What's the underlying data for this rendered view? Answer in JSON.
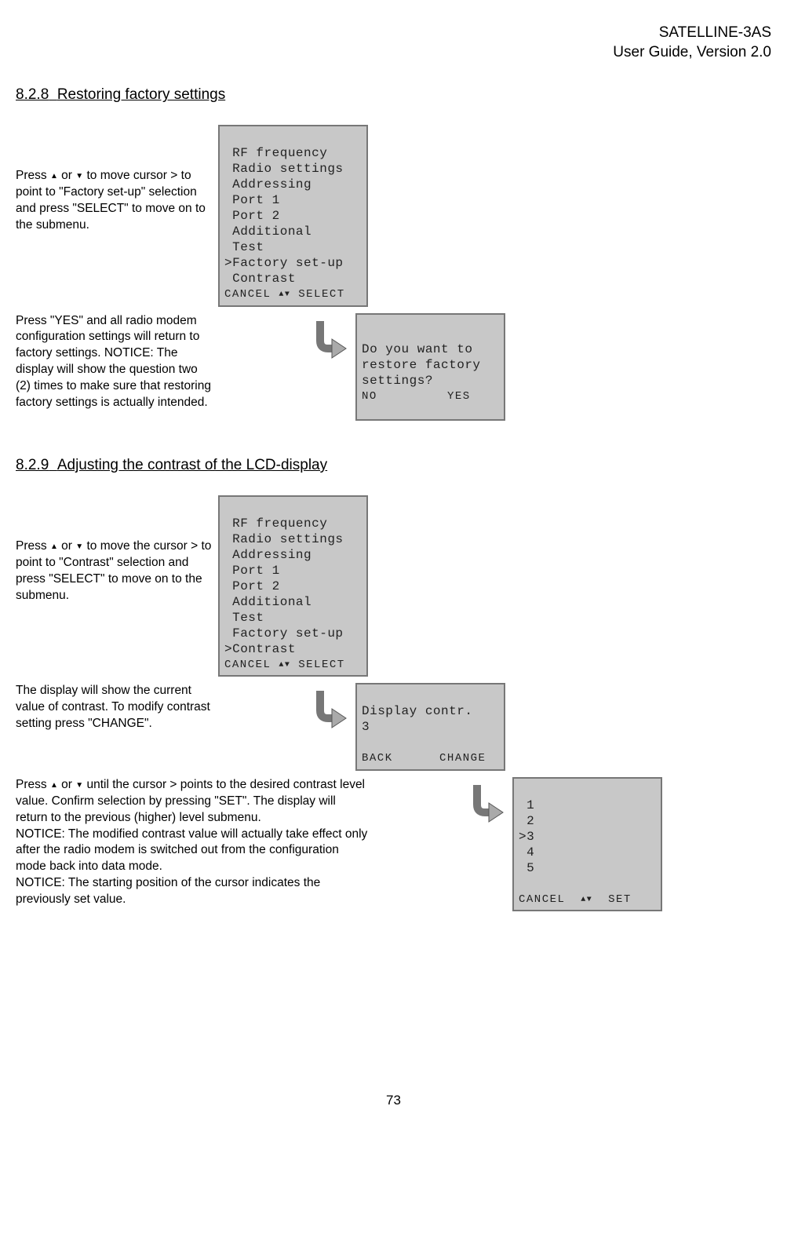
{
  "header": {
    "product": "SATELLINE-3AS",
    "guide": "User Guide, Version 2.0"
  },
  "section1": {
    "num": "8.2.8",
    "title": "Restoring factory settings",
    "instr1_a": "Press ",
    "instr1_b": " or ",
    "instr1_c": " to move cursor > to point to \"Factory set-up\" selection and press \"SELECT\" to move on to the submenu.",
    "instr2_a": "Press \"YES\" and all radio modem configuration settings will return to factory settings. ",
    "instr2_notice": "NOTICE:",
    "instr2_b": " The display will show the question two (2) times to make sure that restoring factory settings is actually intended.",
    "lcd1_lines": " RF frequency\n Radio settings\n Addressing\n Port 1\n Port 2\n Additional\n Test\n>Factory set-up\n Contrast",
    "lcd1_footer_left": "CANCEL",
    "lcd1_footer_right": "SELECT",
    "lcd2_lines": "Do you want to\nrestore factory\nsettings?",
    "lcd2_footer_left": "NO",
    "lcd2_footer_right": "YES"
  },
  "section2": {
    "num": "8.2.9",
    "title": "Adjusting the contrast of the LCD-display",
    "instr1_a": "Press ",
    "instr1_b": " or ",
    "instr1_c": " to move the cursor > to point to \"Contrast\" selection and press \"SELECT\" to move on to the submenu.",
    "instr2": "The display will show the current value of contrast. To modify contrast setting press \"CHANGE\".",
    "instr3_a": "Press ",
    "instr3_b": " or ",
    "instr3_c": "  until the cursor > points to the desired contrast level value. Confirm selection by pressing \"SET\". The display will return to the previous (higher) level submenu.",
    "instr3_notice1": "NOTICE:",
    "instr3_d": " The modified contrast value will actually take effect only after the radio modem is switched out from the configuration mode back into data mode.",
    "instr3_notice2": "NOTICE:",
    "instr3_e": " The starting position of the cursor indicates the previously set value.",
    "lcd1_lines": " RF frequency\n Radio settings\n Addressing\n Port 1\n Port 2\n Additional\n Test\n Factory set-up\n>Contrast",
    "lcd1_footer_left": "CANCEL",
    "lcd1_footer_right": "SELECT",
    "lcd2_lines": "Display contr.\n3\n ",
    "lcd2_footer_left": "BACK",
    "lcd2_footer_right": "CHANGE",
    "lcd3_lines": " 1\n 2\n>3\n 4\n 5\n ",
    "lcd3_footer_left": "CANCEL",
    "lcd3_footer_right": "SET"
  },
  "pagenum": "73"
}
